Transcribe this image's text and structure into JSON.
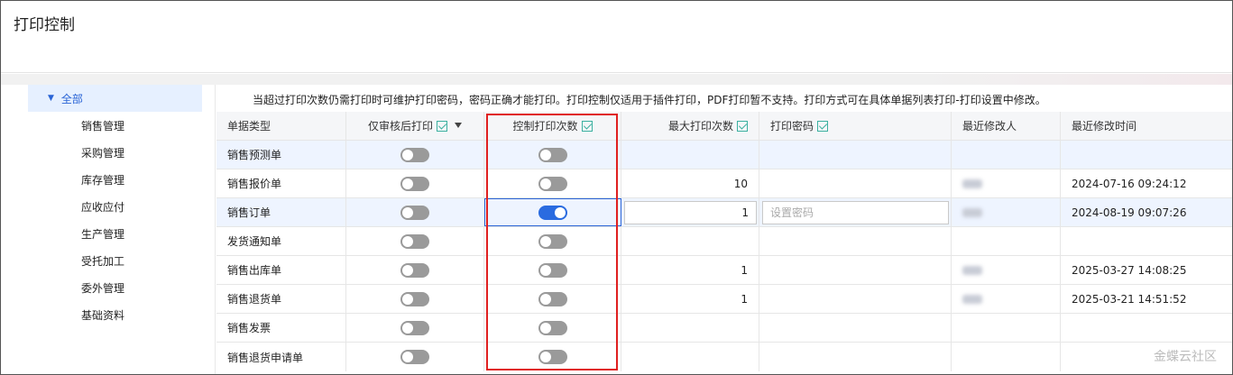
{
  "page": {
    "title": "打印控制"
  },
  "notice": "当超过打印次数仍需打印时可维护打印密码，密码正确才能打印。打印控制仅适用于插件打印，PDF打印暂不支持。打印方式可在具体单据列表打印-打印设置中修改。",
  "tree": {
    "root": "全部",
    "items": [
      "销售管理",
      "采购管理",
      "库存管理",
      "应收应付",
      "生产管理",
      "受托加工",
      "委外管理",
      "基础资料"
    ]
  },
  "table": {
    "headers": [
      "单据类型",
      "仅审核后打印",
      "控制打印次数",
      "最大打印次数",
      "打印密码",
      "最近修改人",
      "最近修改时间"
    ],
    "rows": [
      {
        "type": "销售预测单",
        "audit": false,
        "control": false,
        "max": "",
        "password": "",
        "modifier": "",
        "time": ""
      },
      {
        "type": "销售报价单",
        "audit": false,
        "control": false,
        "max": "10",
        "password": "",
        "modifier": "blurred",
        "time": "2024-07-16 09:24:12"
      },
      {
        "type": "销售订单",
        "audit": false,
        "control": true,
        "max": "1",
        "password": "",
        "modifier": "blurred",
        "time": "2024-08-19 09:07:26"
      },
      {
        "type": "发货通知单",
        "audit": false,
        "control": false,
        "max": "",
        "password": "",
        "modifier": "",
        "time": ""
      },
      {
        "type": "销售出库单",
        "audit": false,
        "control": false,
        "max": "1",
        "password": "",
        "modifier": "blurred",
        "time": "2025-03-27 14:08:25"
      },
      {
        "type": "销售退货单",
        "audit": false,
        "control": false,
        "max": "1",
        "password": "",
        "modifier": "blurred",
        "time": "2025-03-21 14:51:52"
      },
      {
        "type": "销售发票",
        "audit": false,
        "control": false,
        "max": "",
        "password": "",
        "modifier": "",
        "time": ""
      },
      {
        "type": "销售退货申请单",
        "audit": false,
        "control": false,
        "max": "",
        "password": "",
        "modifier": "",
        "time": ""
      }
    ],
    "password_placeholder": "设置密码"
  },
  "watermark": "金蝶云社区"
}
